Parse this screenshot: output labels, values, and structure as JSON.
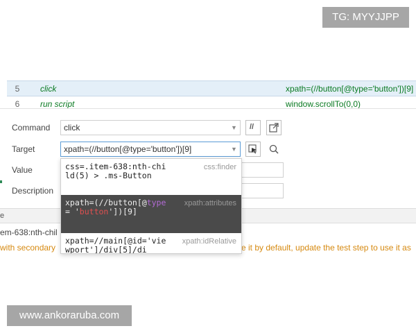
{
  "badge": "TG: MYYJJPP",
  "watermark": "www.ankoraruba.com",
  "rows": [
    {
      "num": "5",
      "command": "click",
      "target": "xpath=(//button[@type='button'])[9]"
    },
    {
      "num": "6",
      "command": "run script",
      "target": "window.scrollTo(0,0)"
    }
  ],
  "editor": {
    "command_label": "Command",
    "command_value": "click",
    "target_label": "Target",
    "target_value": "xpath=(//button[@type='button'])[9]",
    "value_label": "Value",
    "description_label": "Description",
    "toggle_comment_label": "//"
  },
  "dropdown": {
    "options": [
      {
        "code": "css=.item-638:nth-child(5) > .ms-Button",
        "type": "css:finder"
      },
      {
        "code_prefix": "xpath=(//button[@",
        "code_attr": "type",
        "code_eq": "= '",
        "code_val": "bu",
        "code_val2": "tton",
        "code_suffix": "'])[9]",
        "type": "xpath:attributes"
      },
      {
        "code": "xpath=//main[@id='viewport']/div[5]/di",
        "type": "xpath:idRelative"
      }
    ]
  },
  "lower": {
    "strip_text": "e",
    "log_text": "em-638:nth-chil",
    "warning_left": "with secondary",
    "warning_right": "se it by default, update the test step to use it as"
  },
  "colors": {
    "selected_row": "#e4eff8",
    "command_text": "#0a7a22",
    "warning": "#d68910",
    "dropdown_highlight": "#4a4a4a"
  }
}
